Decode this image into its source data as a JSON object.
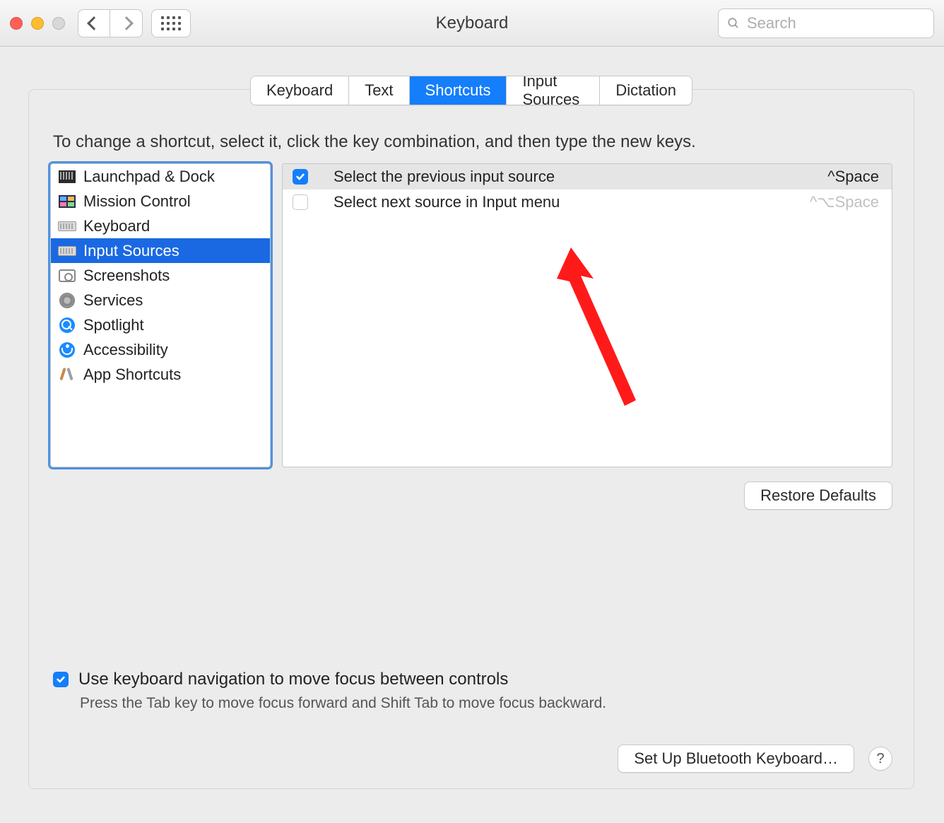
{
  "window": {
    "title": "Keyboard"
  },
  "search": {
    "placeholder": "Search",
    "value": ""
  },
  "tabs": [
    {
      "id": "keyboard",
      "label": "Keyboard",
      "active": false
    },
    {
      "id": "text",
      "label": "Text",
      "active": false
    },
    {
      "id": "shortcuts",
      "label": "Shortcuts",
      "active": true
    },
    {
      "id": "input-sources",
      "label": "Input Sources",
      "active": false
    },
    {
      "id": "dictation",
      "label": "Dictation",
      "active": false
    }
  ],
  "instruction": "To change a shortcut, select it, click the key combination, and then type the new keys.",
  "sidebar": {
    "items": [
      {
        "id": "launchpad-dock",
        "label": "Launchpad & Dock",
        "icon": "launchpad-icon",
        "selected": false
      },
      {
        "id": "mission-control",
        "label": "Mission Control",
        "icon": "mission-icon",
        "selected": false
      },
      {
        "id": "keyboard",
        "label": "Keyboard",
        "icon": "keyboard-icon",
        "selected": false
      },
      {
        "id": "input-sources",
        "label": "Input Sources",
        "icon": "keyboard-icon",
        "selected": true
      },
      {
        "id": "screenshots",
        "label": "Screenshots",
        "icon": "screenshot-icon",
        "selected": false
      },
      {
        "id": "services",
        "label": "Services",
        "icon": "gear-icon",
        "selected": false
      },
      {
        "id": "spotlight",
        "label": "Spotlight",
        "icon": "spotlight-icon",
        "selected": false
      },
      {
        "id": "accessibility",
        "label": "Accessibility",
        "icon": "accessibility-icon",
        "selected": false
      },
      {
        "id": "app-shortcuts",
        "label": "App Shortcuts",
        "icon": "app-shortcuts-icon",
        "selected": false
      }
    ]
  },
  "detail": {
    "rows": [
      {
        "id": "prev-input-source",
        "enabled": true,
        "selected": true,
        "label": "Select the previous input source",
        "shortcut": "^Space"
      },
      {
        "id": "next-input-source",
        "enabled": false,
        "selected": false,
        "label": "Select next source in Input menu",
        "shortcut": "^⌥Space"
      }
    ]
  },
  "buttons": {
    "restore_defaults": "Restore Defaults",
    "bluetooth_setup": "Set Up Bluetooth Keyboard…"
  },
  "keyboard_nav": {
    "enabled": true,
    "label": "Use keyboard navigation to move focus between controls",
    "subtext": "Press the Tab key to move focus forward and Shift Tab to move focus backward."
  },
  "help_tooltip": "?",
  "annotation": {
    "type": "arrow",
    "color": "#ff1a1a",
    "points_to": "detail.rows.0.checkbox"
  }
}
